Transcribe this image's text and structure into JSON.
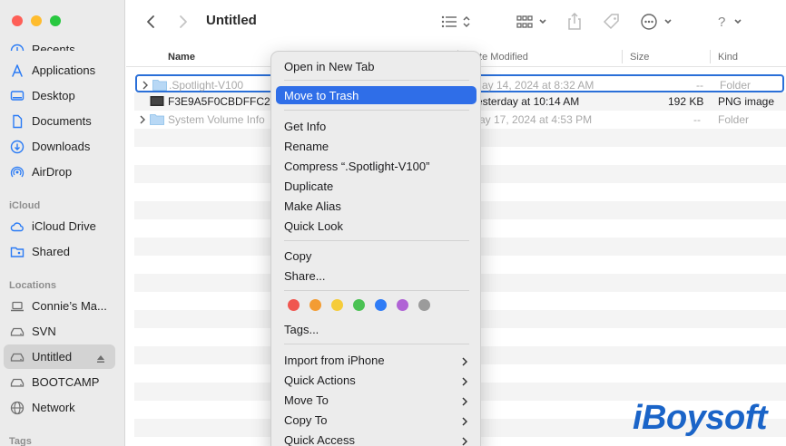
{
  "window": {
    "title": "Untitled"
  },
  "sidebar": {
    "sections": {
      "icloud": "iCloud",
      "locations": "Locations",
      "tags": "Tags"
    },
    "favorites": [
      {
        "label": "Recents",
        "icon": "clock-icon"
      },
      {
        "label": "Applications",
        "icon": "applications-icon"
      },
      {
        "label": "Desktop",
        "icon": "desktop-icon"
      },
      {
        "label": "Documents",
        "icon": "document-icon"
      },
      {
        "label": "Downloads",
        "icon": "download-icon"
      },
      {
        "label": "AirDrop",
        "icon": "airdrop-icon"
      }
    ],
    "icloud": [
      {
        "label": "iCloud Drive",
        "icon": "cloud-icon"
      },
      {
        "label": "Shared",
        "icon": "shared-folder-icon"
      }
    ],
    "locations": [
      {
        "label": "Connie’s Ma...",
        "icon": "laptop-icon"
      },
      {
        "label": "SVN",
        "icon": "drive-icon"
      },
      {
        "label": "Untitled",
        "icon": "drive-icon",
        "selected": true
      },
      {
        "label": "BOOTCAMP",
        "icon": "drive-icon"
      },
      {
        "label": "Network",
        "icon": "network-icon"
      }
    ]
  },
  "columns": {
    "name": "Name",
    "date_modified": "Date Modified",
    "size": "Size",
    "kind": "Kind"
  },
  "files": [
    {
      "name": ".Spotlight-V100",
      "date": "May 14, 2024 at 8:32 AM",
      "size": "--",
      "kind": "Folder",
      "dimmed": true
    },
    {
      "name": "F3E9A5F0CBDFFC2",
      "date": "Yesterday at 10:14 AM",
      "size": "192 KB",
      "kind": "PNG image",
      "dimmed": false
    },
    {
      "name": "System Volume Info",
      "date": "May 17, 2024 at 4:53 PM",
      "size": "--",
      "kind": "Folder",
      "dimmed": true
    }
  ],
  "context_menu": {
    "open_new_tab": "Open in New Tab",
    "move_to_trash": "Move to Trash",
    "get_info": "Get Info",
    "rename": "Rename",
    "compress": "Compress “.Spotlight-V100”",
    "duplicate": "Duplicate",
    "make_alias": "Make Alias",
    "quick_look": "Quick Look",
    "copy": "Copy",
    "share": "Share...",
    "tags_label": "Tags...",
    "tag_colors": [
      "#f05650",
      "#f39c33",
      "#f5cc3a",
      "#4bc254",
      "#2f7cf6",
      "#b063d5",
      "#9b9b9b"
    ],
    "import_iphone": "Import from iPhone",
    "quick_actions": "Quick Actions",
    "move_to": "Move To",
    "copy_to": "Copy To",
    "quick_access": "Quick Access"
  },
  "watermark": "iBoysoft"
}
